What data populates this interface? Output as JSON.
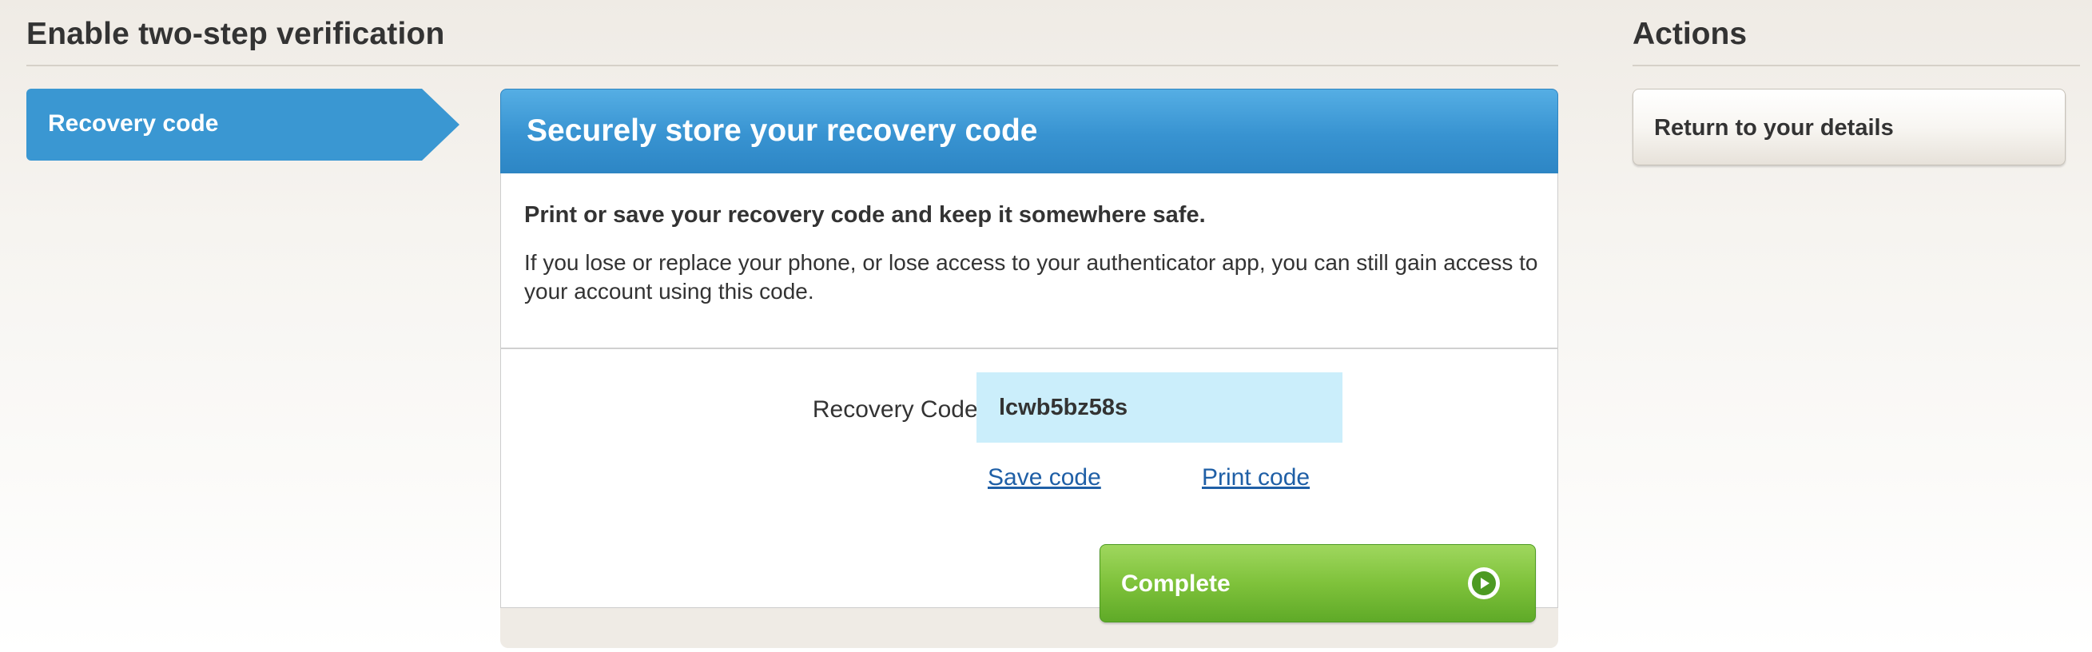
{
  "header": {
    "title": "Enable two-step verification",
    "actions_title": "Actions"
  },
  "steps": {
    "active_label": "Recovery code"
  },
  "card": {
    "title": "Securely store your recovery code",
    "lead": "Print or save your recovery code and keep it somewhere safe.",
    "description": "If you lose or replace your phone, or lose access to your authenticator app, you can still gain access to your account using this code.",
    "code_label": "Recovery Code:",
    "code_value": "lcwb5bz58s",
    "save_link": "Save code",
    "print_link": "Print code",
    "complete_label": "Complete",
    "complete_icon": "play-arrow-icon"
  },
  "actions": {
    "return_label": "Return to your details"
  },
  "colors": {
    "header_blue": "#3893d1",
    "step_blue": "#3a97d2",
    "complete_green": "#7fc23b",
    "code_highlight": "#cbeefb",
    "link_blue": "#1f5fa6"
  }
}
